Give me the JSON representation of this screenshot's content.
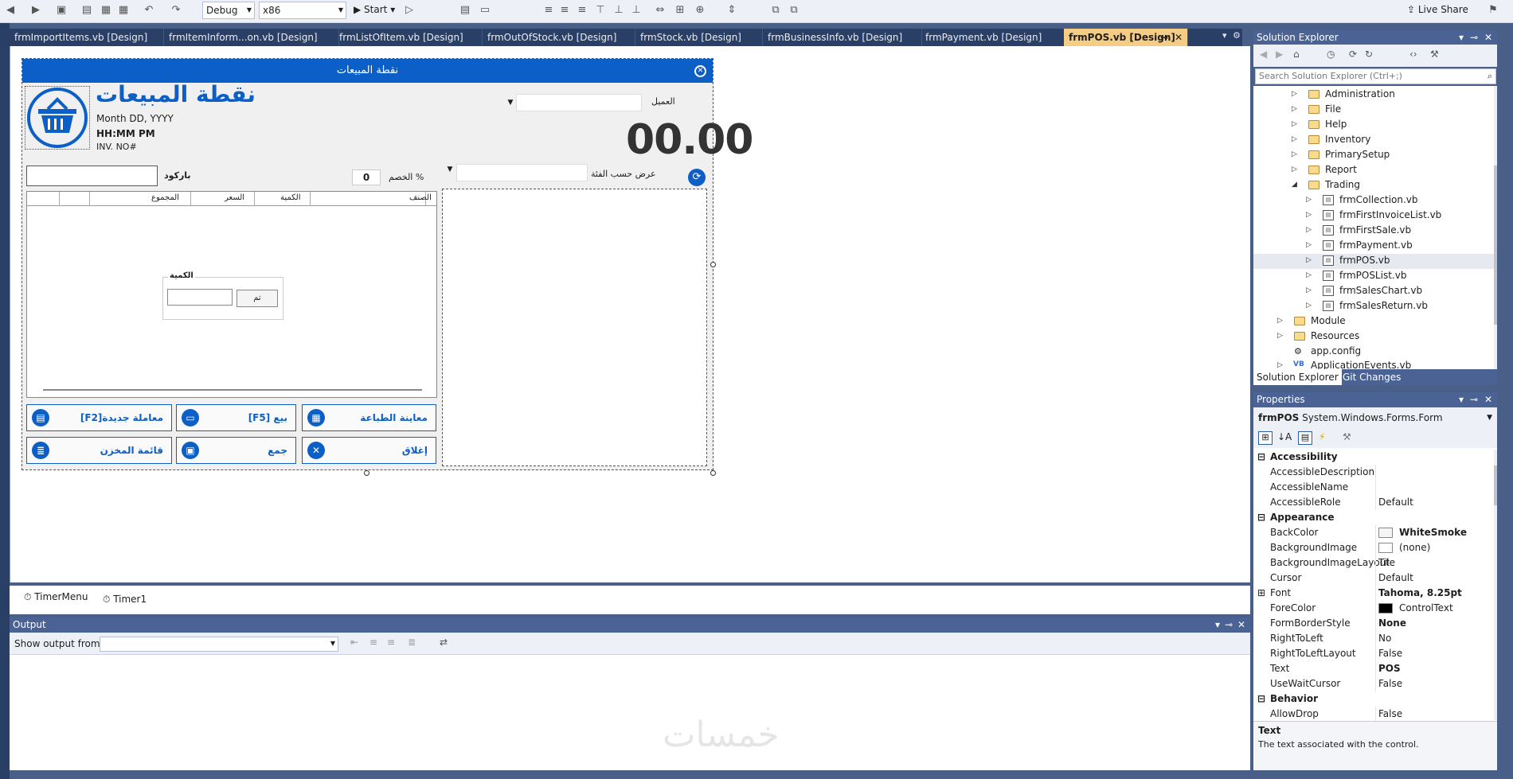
{
  "toolbar": {
    "config": "Debug",
    "platform": "x86",
    "start_label": "Start",
    "live_share": "Live Share"
  },
  "tabs": [
    "frmImportItems.vb [Design]",
    "frmItemInform...on.vb [Design]",
    "frmListOfItem.vb [Design]",
    "frmOutOfStock.vb [Design]",
    "frmStock.vb [Design]",
    "frmBusinessInfo.vb [Design]",
    "frmPayment.vb [Design]",
    "frmPOS.vb [Design]"
  ],
  "form": {
    "title": "نقطة المبيعات",
    "heading": "نقطة المبيعات",
    "date": "Month DD, YYYY",
    "time": "HH:MM PM",
    "invoice": "INV. NO#",
    "customer_label": "العميل",
    "total": "00.00",
    "barcode_label": "باركود",
    "discount_label": "الخصم %",
    "discount_value": "0",
    "category_label": "عرض حسب الفئة",
    "grid_headers": [
      "الصنف",
      "الكمية",
      "السعر",
      "المجموع"
    ],
    "qty_group_title": "الكمية",
    "qty_ok": "تم",
    "buttons": {
      "new": "[F2]معاملة جديدة",
      "sell": "[F5] بيع",
      "print_preview": "معاينة الطباعة",
      "stock_list": "قائمة المخزن",
      "sum": "جمع",
      "close": "إغلاق"
    }
  },
  "components": [
    "TimerMenu",
    "Timer1"
  ],
  "output": {
    "title": "Output",
    "show_from": "Show output from:"
  },
  "solution_explorer": {
    "title": "Solution Explorer",
    "search_placeholder": "Search Solution Explorer (Ctrl+;)",
    "items": [
      "Administration",
      "File",
      "Help",
      "Inventory",
      "PrimarySetup",
      "Report",
      "Trading",
      "frmCollection.vb",
      "frmFirstInvoiceList.vb",
      "frmFirstSale.vb",
      "frmPayment.vb",
      "frmPOS.vb",
      "frmPOSList.vb",
      "frmSalesChart.vb",
      "frmSalesReturn.vb",
      "Module",
      "Resources",
      "app.config",
      "ApplicationEvents.vb"
    ],
    "tab_solution": "Solution Explorer",
    "tab_git": "Git Changes"
  },
  "properties": {
    "title": "Properties",
    "object_name": "frmPOS",
    "object_type": "System.Windows.Forms.Form",
    "rows": [
      {
        "cat": true,
        "name": "Accessibility",
        "value": ""
      },
      {
        "name": "AccessibleDescription",
        "value": ""
      },
      {
        "name": "AccessibleName",
        "value": ""
      },
      {
        "name": "AccessibleRole",
        "value": "Default"
      },
      {
        "cat": true,
        "name": "Appearance",
        "value": ""
      },
      {
        "name": "BackColor",
        "value": "WhiteSmoke",
        "swatch": "#f5f5f5",
        "bold": true
      },
      {
        "name": "BackgroundImage",
        "value": "(none)",
        "swatch": "#ffffff"
      },
      {
        "name": "BackgroundImageLayout",
        "value": "Tile"
      },
      {
        "name": "Cursor",
        "value": "Default"
      },
      {
        "name": "Font",
        "value": "Tahoma, 8.25pt",
        "bold": true
      },
      {
        "name": "ForeColor",
        "value": "ControlText",
        "swatch": "#000000"
      },
      {
        "name": "FormBorderStyle",
        "value": "None",
        "bold": true
      },
      {
        "name": "RightToLeft",
        "value": "No"
      },
      {
        "name": "RightToLeftLayout",
        "value": "False"
      },
      {
        "name": "Text",
        "value": "POS",
        "bold": true
      },
      {
        "name": "UseWaitCursor",
        "value": "False"
      },
      {
        "cat": true,
        "name": "Behavior",
        "value": ""
      },
      {
        "name": "AllowDrop",
        "value": "False"
      }
    ],
    "desc_title": "Text",
    "desc_text": "The text associated with the control."
  },
  "watermark": "خمسات"
}
